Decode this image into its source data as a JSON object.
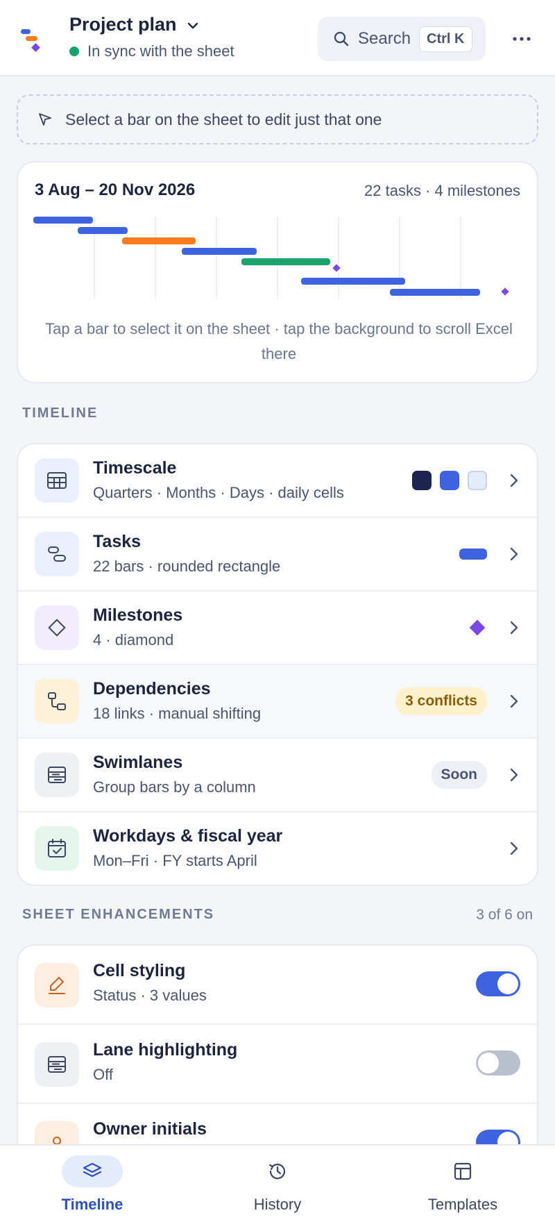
{
  "header": {
    "title": "Project plan",
    "status": "In sync with the sheet",
    "search_label": "Search",
    "shortcut": "Ctrl K",
    "icons": [
      "app-logo",
      "chevron-down-icon",
      "search-icon",
      "more-icon"
    ]
  },
  "hint": {
    "text": "Select a bar on the sheet to edit just that one",
    "icon": "cursor-icon"
  },
  "preview": {
    "range": "3 Aug – 20 Nov 2026",
    "counts": "22 tasks · 4 milestones",
    "help": "Tap a bar to select it on the sheet · tap the background to scroll Excel there",
    "colors": {
      "task": "#3d63e0",
      "accent": "#f97b1c",
      "done": "#1aa36b",
      "milestone": "#7b47e6"
    }
  },
  "timeline": {
    "section_label": "TIMELINE",
    "rows": [
      {
        "title": "Timescale",
        "subtitle": "Quarters · Months · Days · daily cells",
        "icon": "table-icon",
        "swatches": [
          "#1c2452",
          "#3d63e0",
          "#e4ebfb"
        ]
      },
      {
        "title": "Tasks",
        "subtitle": "22 bars · rounded rectangle",
        "icon": "task-bars-icon"
      },
      {
        "title": "Milestones",
        "subtitle": "4 · diamond",
        "icon": "diamond-icon"
      },
      {
        "title": "Dependencies",
        "subtitle": "18 links · manual shifting",
        "icon": "dependency-icon",
        "badge": "3 conflicts"
      },
      {
        "title": "Swimlanes",
        "subtitle": "Group bars by a column",
        "icon": "lanes-icon",
        "badge": "Soon"
      },
      {
        "title": "Workdays & fiscal year",
        "subtitle": "Mon–Fri · FY starts April",
        "icon": "calendar-icon"
      }
    ]
  },
  "enhancements": {
    "section_label": "SHEET ENHANCEMENTS",
    "count": "3 of 6 on",
    "rows": [
      {
        "title": "Cell styling",
        "subtitle": "Status · 3 values",
        "icon": "brush-icon",
        "enabled": true
      },
      {
        "title": "Lane highlighting",
        "subtitle": "Off",
        "icon": "lanes-icon",
        "enabled": false
      },
      {
        "title": "Owner initials",
        "subtitle": "",
        "icon": "person-icon",
        "enabled": true
      }
    ]
  },
  "nav": {
    "items": [
      {
        "label": "Timeline",
        "icon": "layers-icon",
        "active": true
      },
      {
        "label": "History",
        "icon": "history-icon",
        "active": false
      },
      {
        "label": "Templates",
        "icon": "template-icon",
        "active": false
      }
    ]
  }
}
